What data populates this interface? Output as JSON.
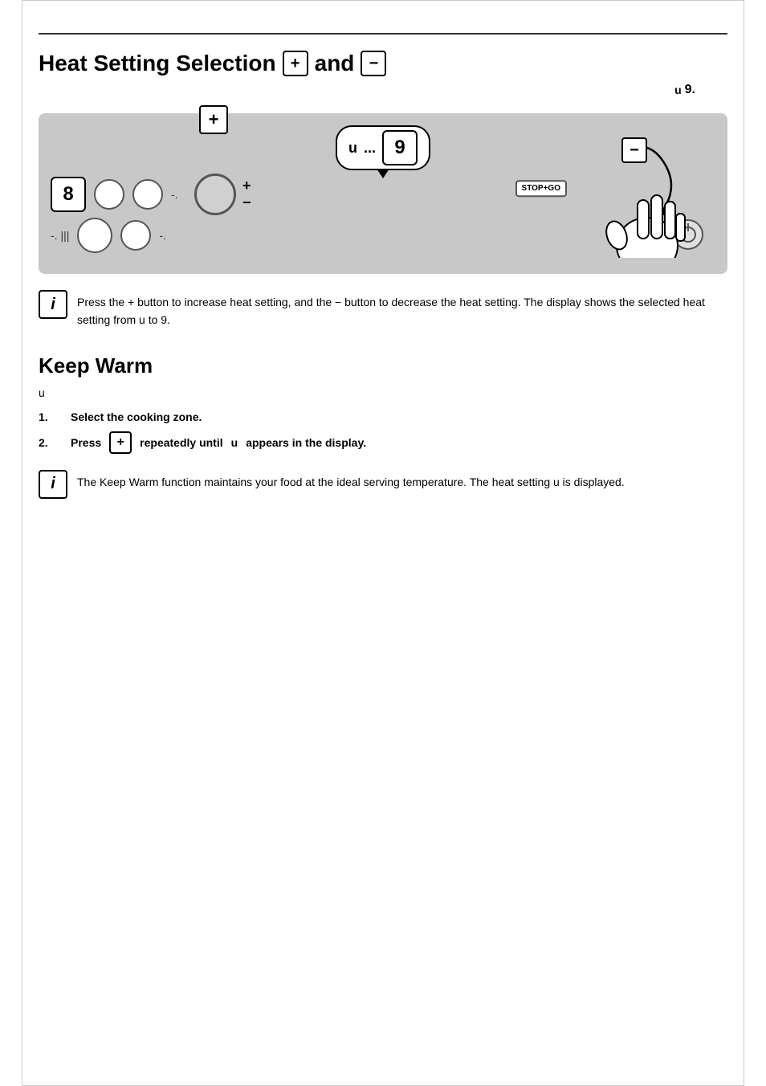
{
  "page": {
    "title": "Heat Setting Selection",
    "title_and": "and",
    "subtitle_u": "u",
    "subtitle_nine": "9.",
    "info_text_1": "Press the + button to increase heat setting, and the − button to decrease the heat setting. The display shows the selected heat setting from u to 9.",
    "keep_warm_title": "Keep Warm",
    "keep_warm_subtitle_u": "u",
    "step1_number": "1.",
    "step1_text": "Select the cooking zone.",
    "step2_number": "2.",
    "step2_text": "Press",
    "step2_u": "u",
    "step2_text2": "repeatedly until",
    "step2_end": "appears in the display.",
    "info_text_2": "The Keep Warm function maintains your food at the ideal serving temperature. The heat setting u is displayed.",
    "display_u": "u",
    "display_dots": "...",
    "display_nine": "9",
    "panel_num": "8",
    "stopgo": "STOP+GO",
    "plus_symbol": "+",
    "minus_symbol": "−"
  }
}
